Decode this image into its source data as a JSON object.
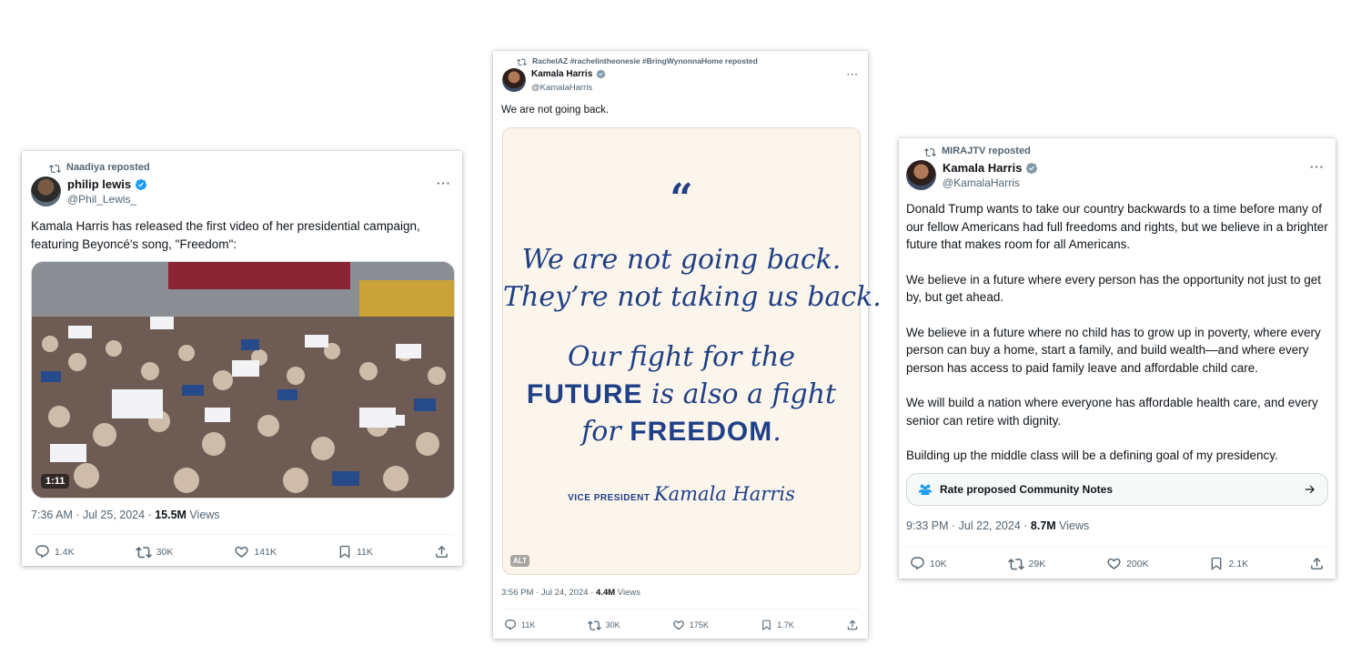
{
  "tweets": [
    {
      "reposter": "Naadiya reposted",
      "name": "philip lewis",
      "handle": "@Phil_Lewis_",
      "text": "Kamala Harris has released the first video of her presidential campaign, featuring Beyoncé's song, \"Freedom\":",
      "video_duration": "1:11",
      "timestamp": "7:36 AM · Jul 25, 2024 · ",
      "views_count": "15.5M",
      "views_label": " Views",
      "replies": "1.4K",
      "reposts": "30K",
      "likes": "141K",
      "bookmarks": "11K"
    },
    {
      "reposter": "RachelAZ #rachelintheonesie #BringWynonnaHome reposted",
      "name": "Kamala Harris",
      "handle": "@KamalaHarris",
      "text": "We are not going back.",
      "image": {
        "quote_mark": "“",
        "line1": "We are not going back.",
        "line2": "They’re not taking us back.",
        "line3": "Our fight for the",
        "line4_bold": "FUTURE",
        "line4_rest": " is also a fight",
        "line5_pre": "for ",
        "line5_bold": "FREEDOM",
        "line5_end": ".",
        "sig_title": "VICE PRESIDENT",
        "sig_name": "Kamala Harris",
        "alt_badge": "ALT"
      },
      "timestamp": "3:56 PM · Jul 24, 2024 · ",
      "views_count": "4.4M",
      "views_label": " Views",
      "replies": "11K",
      "reposts": "30K",
      "likes": "175K",
      "bookmarks": "1.7K"
    },
    {
      "reposter": "MIRAJTV reposted",
      "name": "Kamala Harris",
      "handle": "@KamalaHarris",
      "paragraphs": [
        "Donald Trump wants to take our country backwards to a time before many of our fellow Americans had full freedoms and rights, but we believe in a brighter future that makes room for all Americans.",
        "We believe in a future where every person has the opportunity not just to get by, but get ahead.",
        "We believe in a future where no child has to grow up in poverty, where every person can buy a home, start a family, and build wealth—and where every person has access to paid family leave and affordable child care.",
        "We will build a nation where everyone has affordable health care, and every senior can retire with dignity.",
        "Building up the middle class will be a defining goal of my presidency."
      ],
      "community_notes": "Rate proposed Community Notes",
      "timestamp": "9:33 PM · Jul 22, 2024 · ",
      "views_count": "8.7M",
      "views_label": " Views",
      "replies": "10K",
      "reposts": "29K",
      "likes": "200K",
      "bookmarks": "2.1K"
    }
  ],
  "colors": {
    "verified": "#1d9bf0",
    "harris_blue": "#1f3f86",
    "quote_bg": "#fcf5ec",
    "muted": "#536471"
  },
  "icons": [
    "repost-icon",
    "verified-badge-icon",
    "more-icon",
    "reply-icon",
    "like-icon",
    "bookmark-icon",
    "share-icon",
    "community-notes-icon",
    "arrow-right-icon"
  ]
}
